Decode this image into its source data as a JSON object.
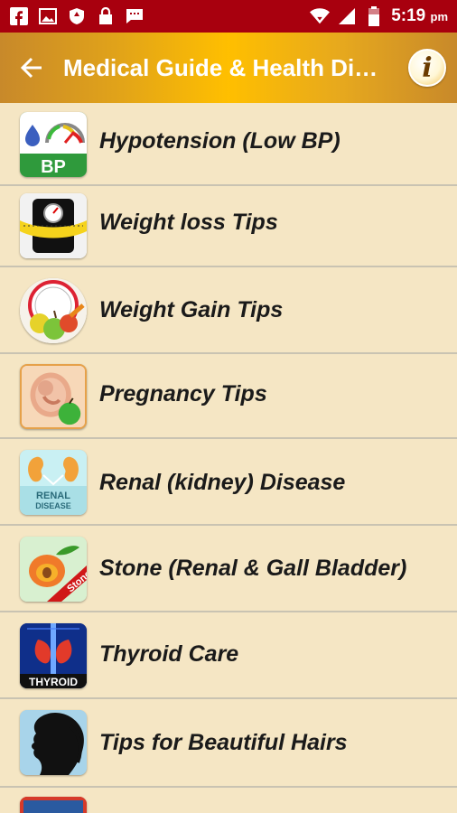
{
  "status_bar": {
    "time": "5:19",
    "ampm": "pm",
    "icons": [
      "facebook-icon",
      "image-icon",
      "shield-icon",
      "lock-icon",
      "message-icon",
      "wifi-icon",
      "signal-icon",
      "battery-icon"
    ]
  },
  "app_bar": {
    "title": "Medical Guide & Health Di…",
    "back_icon": "arrow-left-icon",
    "info_label": "i"
  },
  "list": {
    "items": [
      {
        "label": "Hypotension (Low BP)",
        "icon": "bp-meter-icon"
      },
      {
        "label": "Weight loss Tips",
        "icon": "scale-tape-icon"
      },
      {
        "label": "Weight Gain Tips",
        "icon": "fruits-scale-icon"
      },
      {
        "label": "Pregnancy Tips",
        "icon": "pregnancy-icon"
      },
      {
        "label": "Renal (kidney) Disease",
        "icon": "kidney-icon"
      },
      {
        "label": "Stone (Renal & Gall Bladder)",
        "icon": "stone-fruit-icon"
      },
      {
        "label": "Thyroid Care",
        "icon": "thyroid-icon"
      },
      {
        "label": "Tips for Beautiful Hairs",
        "icon": "hair-silhouette-icon"
      }
    ]
  }
}
